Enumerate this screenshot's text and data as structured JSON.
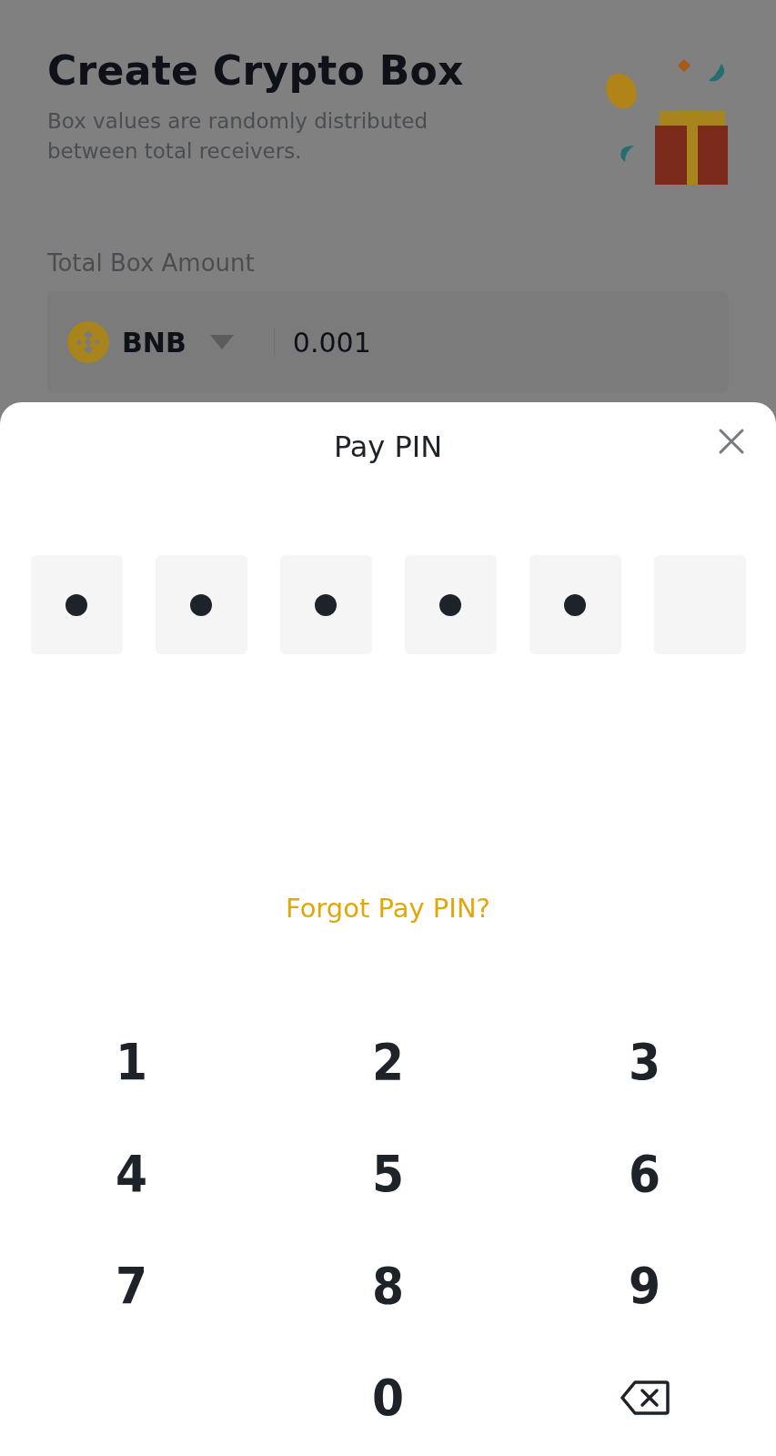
{
  "page": {
    "title": "Create Crypto Box",
    "subtitle": "Box values are randomly distributed between total receivers.",
    "amount_label": "Total Box Amount",
    "coin": "BNB",
    "amount": "0.001"
  },
  "sheet": {
    "title": "Pay PIN",
    "forgot_link": "Forgot Pay PIN?",
    "pin": [
      {
        "filled": true
      },
      {
        "filled": true
      },
      {
        "filled": true
      },
      {
        "filled": true
      },
      {
        "filled": true
      },
      {
        "filled": false
      }
    ],
    "keys": [
      {
        "kind": "digit",
        "label": "1"
      },
      {
        "kind": "digit",
        "label": "2"
      },
      {
        "kind": "digit",
        "label": "3"
      },
      {
        "kind": "digit",
        "label": "4"
      },
      {
        "kind": "digit",
        "label": "5"
      },
      {
        "kind": "digit",
        "label": "6"
      },
      {
        "kind": "digit",
        "label": "7"
      },
      {
        "kind": "digit",
        "label": "8"
      },
      {
        "kind": "digit",
        "label": "9"
      },
      {
        "kind": "empty"
      },
      {
        "kind": "digit",
        "label": "0"
      },
      {
        "kind": "backspace"
      }
    ]
  }
}
